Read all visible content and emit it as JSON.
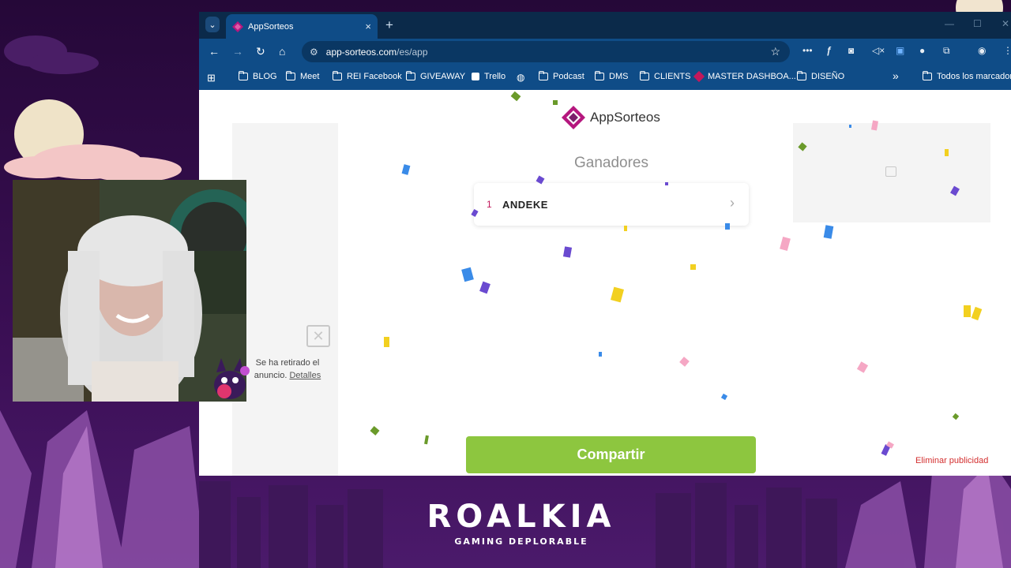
{
  "browser": {
    "tab": {
      "title": "AppSorteos",
      "close": "×"
    },
    "new_tab": "+",
    "tab_menu": "⌄",
    "url_host": "app-sorteos.com",
    "url_path": "/es/app",
    "bookmarks": [
      "BLOG",
      "Meet",
      "REI Facebook",
      "GIVEAWAY",
      "Trello",
      "",
      "Podcast",
      "DMS",
      "CLIENTS",
      "MASTER DASHBOA...",
      "DISEÑO"
    ],
    "more_bookmarks": "»",
    "all_bookmarks": "Todos los marcadores"
  },
  "page": {
    "logo_text": "AppSorteos",
    "winners_title": "Ganadores",
    "winners": [
      {
        "position": "1",
        "name": "ANDEKE"
      }
    ],
    "share_button": "Compartir",
    "remove_ads": "Eliminar publicidad",
    "ad_removed": "Se ha retirado el anuncio.",
    "ad_details": "Detalles"
  },
  "overlay": {
    "brand_title": "ROALKIA",
    "brand_subtitle": "GAMING DEPLORABLE"
  },
  "colors": {
    "tab_bar": "#0b2a4a",
    "toolbar": "#0f4c87",
    "share_button": "#8dc63f",
    "remove_ads": "#d32f2f",
    "winner_number": "#c2185b",
    "logo_accent": "#b5177e"
  }
}
